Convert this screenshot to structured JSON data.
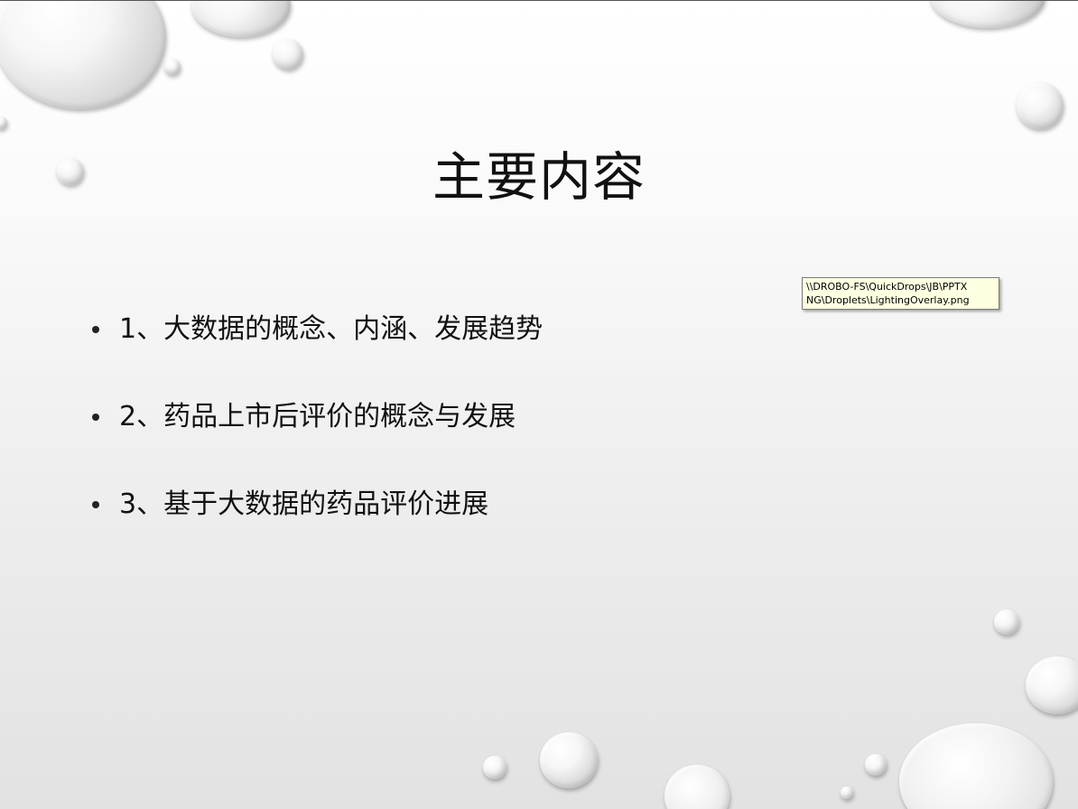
{
  "slide": {
    "title": "主要内容",
    "bullets": [
      "1、大数据的概念、内涵、发展趋势",
      "2、药品上市后评价的概念与发展",
      "3、基于大数据的药品评价进展"
    ]
  },
  "tooltip": {
    "line1": "\\\\DROBO-FS\\QuickDrops\\JB\\PPTX",
    "line2": "NG\\Droplets\\LightingOverlay.png"
  }
}
